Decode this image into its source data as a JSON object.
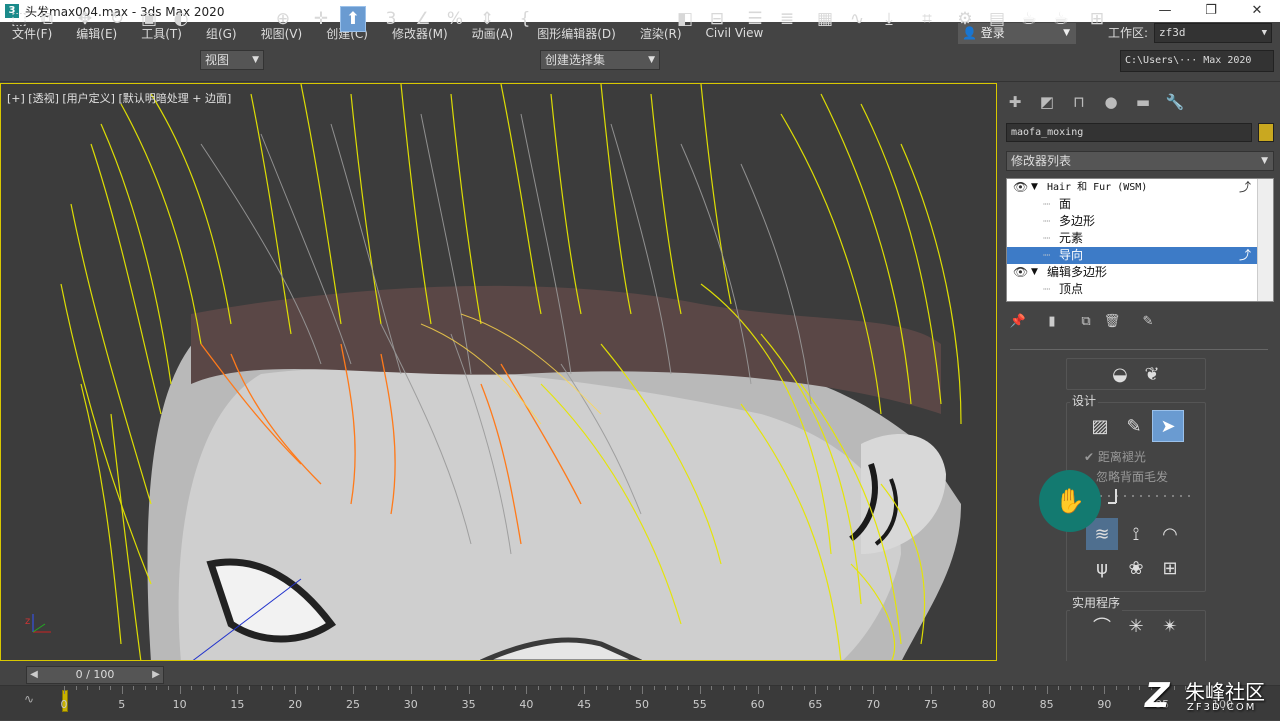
{
  "title_bar": {
    "title": "头发max004.max - 3ds Max 2020",
    "minimize": "—",
    "maximize": "❐",
    "close": "✕"
  },
  "menu": [
    "文件(F)",
    "编辑(E)",
    "工具(T)",
    "组(G)",
    "视图(V)",
    "创建(C)",
    "修改器(M)",
    "动画(A)",
    "图形编辑器(D)",
    "渲染(R)",
    "Civil View"
  ],
  "login_label": "登录",
  "workspace": {
    "label": "工作区:",
    "value": "zf3d"
  },
  "toolbar": {
    "view_dropdown": "视图",
    "selection_set": "创建选择集",
    "path": "C:\\Users\\··· Max 2020"
  },
  "viewport": {
    "label": "[+] [透视] [用户定义] [默认明暗处理 + 边面]"
  },
  "command_panel": {
    "object_name": "maofa_moxing",
    "object_color": "#c9a820",
    "modifier_list": "修改器列表",
    "stack": [
      {
        "label": "Hair 和 Fur (WSM)",
        "level": 0,
        "eye": true,
        "selected": false
      },
      {
        "label": "面",
        "level": 1,
        "eye": false,
        "selected": false
      },
      {
        "label": "多边形",
        "level": 1,
        "eye": false,
        "selected": false
      },
      {
        "label": "元素",
        "level": 1,
        "eye": false,
        "selected": false
      },
      {
        "label": "导向",
        "level": 1,
        "eye": false,
        "selected": true
      },
      {
        "label": "编辑多边形",
        "level": 0,
        "eye": true,
        "selected": false
      },
      {
        "label": "顶点",
        "level": 1,
        "eye": false,
        "selected": false
      }
    ],
    "design_title": "设计",
    "option1": "距离褪光",
    "option2": "忽略背面毛发",
    "utility_title": "实用程序"
  },
  "timeline": {
    "frame_display": "0 / 100",
    "ticks": [
      "0",
      "5",
      "10",
      "15",
      "20",
      "25",
      "30",
      "35",
      "40",
      "45",
      "50",
      "55",
      "60",
      "65",
      "70",
      "75",
      "80",
      "85",
      "90",
      "95",
      "100"
    ]
  },
  "watermark": {
    "logo": "Z",
    "name": "朱峰社区",
    "url": "ZF3D.COM"
  }
}
